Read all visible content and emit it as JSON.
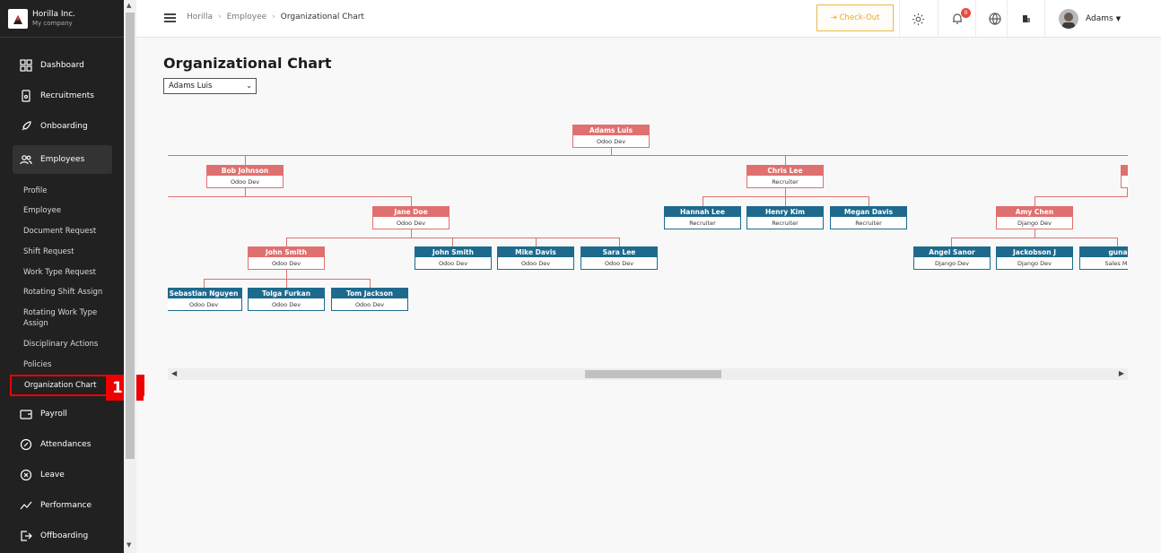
{
  "brand": {
    "name": "Horilla Inc.",
    "sub": "My company"
  },
  "sidebar": {
    "items": [
      {
        "label": "Dashboard",
        "icon": "grid-icon"
      },
      {
        "label": "Recruitments",
        "icon": "phone-icon"
      },
      {
        "label": "Onboarding",
        "icon": "rocket-icon"
      },
      {
        "label": "Employees",
        "icon": "people-icon"
      },
      {
        "label": "Payroll",
        "icon": "wallet-icon"
      },
      {
        "label": "Attendances",
        "icon": "clock-icon"
      },
      {
        "label": "Leave",
        "icon": "close-circle-icon"
      },
      {
        "label": "Performance",
        "icon": "chart-line-icon"
      },
      {
        "label": "Offboarding",
        "icon": "exit-icon"
      }
    ],
    "sub_items": [
      "Profile",
      "Employee",
      "Document Request",
      "Shift Request",
      "Work Type Request",
      "Rotating Shift Assign",
      "Rotating Work Type Assign",
      "Disciplinary Actions",
      "Policies",
      "Organization Chart"
    ],
    "marker": "1"
  },
  "topbar": {
    "breadcrumbs": [
      "Horilla",
      "Employee",
      "Organizational Chart"
    ],
    "checkout_label": "Check-Out",
    "notif_count": "0",
    "user_name": "Adams"
  },
  "main": {
    "title": "Organizational Chart",
    "selected_employee": "Adams Luis"
  },
  "org": {
    "root": {
      "name": "Adams Luis",
      "role": "Odoo Dev"
    },
    "bob": {
      "name": "Bob Johnson",
      "role": "Odoo Dev"
    },
    "chris": {
      "name": "Chris Lee",
      "role": "Recruiter"
    },
    "jane": {
      "name": "Jane Doe",
      "role": "Odoo Dev"
    },
    "hannah": {
      "name": "Hannah Lee",
      "role": "Recruiter"
    },
    "henry": {
      "name": "Henry Kim",
      "role": "Recruiter"
    },
    "megan": {
      "name": "Megan Davis",
      "role": "Recruiter"
    },
    "amy": {
      "name": "Amy Chen",
      "role": "Django Dev"
    },
    "johns": {
      "name": "John Smith",
      "role": "Odoo Dev"
    },
    "johnsm": {
      "name": "John Smith",
      "role": "Odoo Dev"
    },
    "mike": {
      "name": "Mike Davis",
      "role": "Odoo Dev"
    },
    "sara": {
      "name": "Sara Lee",
      "role": "Odoo Dev"
    },
    "angel": {
      "name": "Angel Sanor",
      "role": "Django Dev"
    },
    "jackobson": {
      "name": "Jackobson J",
      "role": "Django Dev"
    },
    "guna": {
      "name": "guna",
      "role": "Sales Ma"
    },
    "sebastian": {
      "name": "Sebastian Nguyen",
      "role": "Odoo Dev"
    },
    "tolga": {
      "name": "Tolga Furkan",
      "role": "Odoo Dev"
    },
    "tom": {
      "name": "Tom Jackson",
      "role": "Odoo Dev"
    }
  },
  "colors": {
    "manager": "#e07070",
    "member": "#1e6a8e",
    "accent": "#e8a829",
    "sidebar": "#212121"
  }
}
